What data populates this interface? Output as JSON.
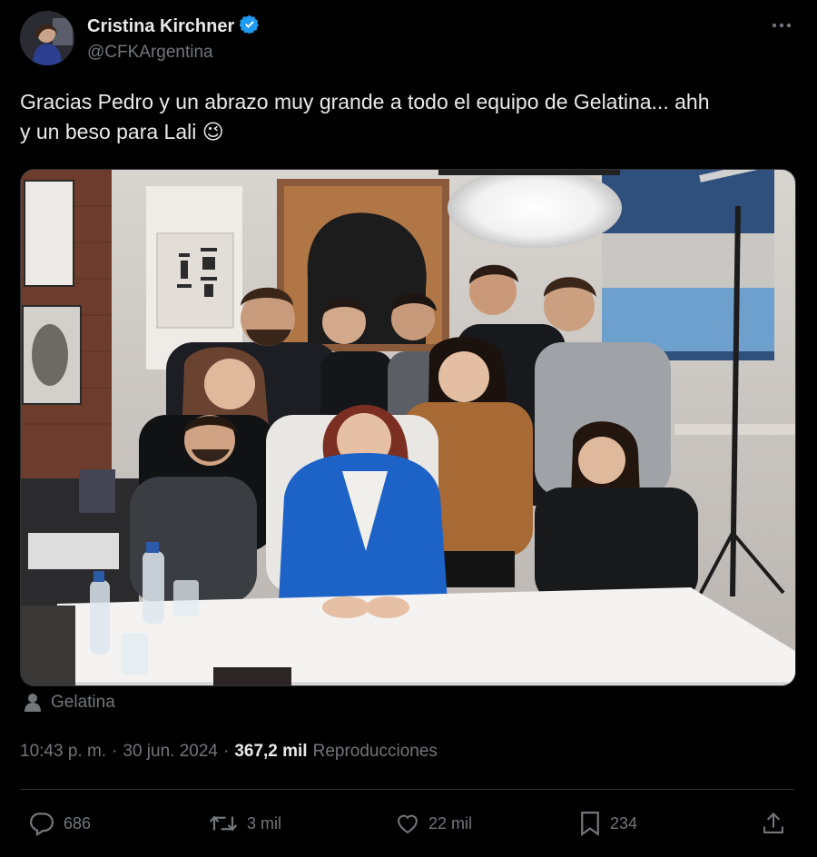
{
  "author": {
    "display_name": "Cristina Kirchner",
    "handle": "@CFKArgentina",
    "verified": true
  },
  "tweet": {
    "text_line1": "Gracias Pedro y un abrazo muy grande a todo el equipo de Gelatina... ahh",
    "text_line2": "y un beso para Lali",
    "emoji": "😉"
  },
  "media": {
    "type": "photo"
  },
  "location": {
    "label": "Gelatina",
    "icon": "person-icon"
  },
  "meta": {
    "time": "10:43 p. m.",
    "separator": "·",
    "date": "30 jun. 2024",
    "views_count": "367,2 mil",
    "views_label": "Reproducciones"
  },
  "actions": {
    "replies": "686",
    "retweets": "3 mil",
    "likes": "22 mil",
    "bookmarks": "234"
  },
  "colors": {
    "background": "#000000",
    "text_primary": "#e7e9ea",
    "text_secondary": "#71767b",
    "verified_badge": "#1d9bf0",
    "divider": "#2f3336"
  }
}
